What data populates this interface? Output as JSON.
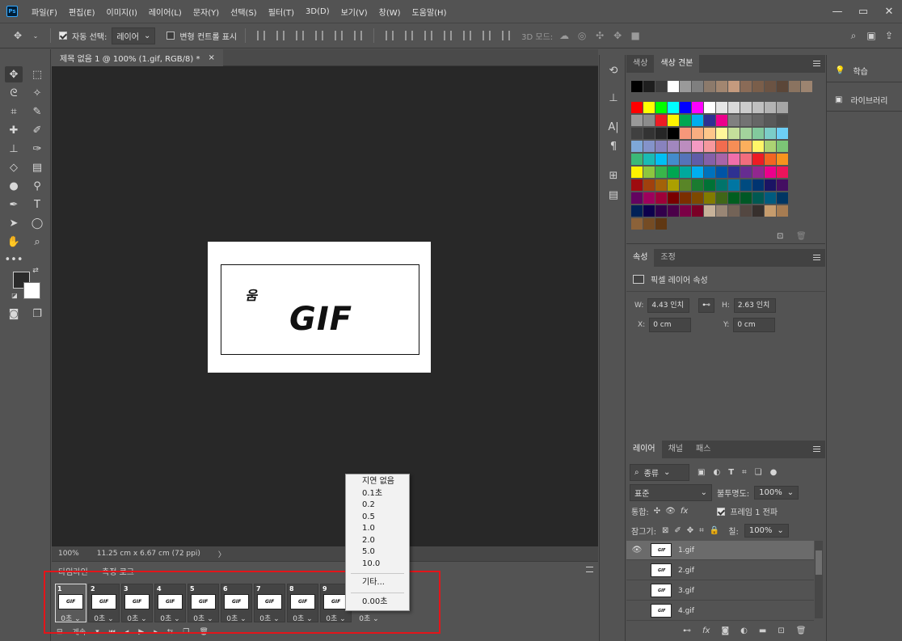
{
  "menubar": {
    "logo": "Ps",
    "items": [
      "파일(F)",
      "편집(E)",
      "이미지(I)",
      "레이어(L)",
      "문자(Y)",
      "선택(S)",
      "필터(T)",
      "3D(D)",
      "보기(V)",
      "창(W)",
      "도움말(H)"
    ]
  },
  "window": {
    "minimize": "—",
    "maximize": "▭",
    "close": "✕"
  },
  "options": {
    "auto_select_label": "자동 선택:",
    "auto_select_value": "레이어",
    "transform_label": "변형 컨트롤 표시",
    "mode_3d_label": "3D 모드:"
  },
  "document": {
    "tab_title": "제목 없음 1 @ 100% (1.gif, RGB/8) *",
    "tab_close": "×",
    "canvas_small_text": "움",
    "canvas_big_text": "GIF",
    "zoom": "100%",
    "doc_size": "11.25 cm x 6.67 cm (72 ppi)",
    "status_arrow": "〉"
  },
  "timeline": {
    "tab_timeline": "타임라인",
    "tab_measure": "측정 로그",
    "frames": [
      {
        "num": "1",
        "delay": "0초"
      },
      {
        "num": "2",
        "delay": "0초"
      },
      {
        "num": "3",
        "delay": "0초"
      },
      {
        "num": "4",
        "delay": "0초"
      },
      {
        "num": "5",
        "delay": "0초"
      },
      {
        "num": "6",
        "delay": "0초"
      },
      {
        "num": "7",
        "delay": "0초"
      },
      {
        "num": "8",
        "delay": "0초"
      },
      {
        "num": "9",
        "delay": "0초"
      },
      {
        "num": "",
        "delay": "0초"
      }
    ],
    "loop_label": "계속"
  },
  "delay_menu": {
    "items": [
      "지연 없음",
      "0.1초",
      "0.2",
      "0.5",
      "1.0",
      "2.0",
      "5.0",
      "10.0"
    ],
    "other": "기타...",
    "current": "0.00초"
  },
  "swatches": {
    "tab_color": "색상",
    "tab_swatches": "색상 견본",
    "rows": [
      [
        "#000000",
        "#1e1e1e",
        "#3c3c3c",
        "#ffffff",
        "#9a9a9a",
        "#7f7f7f",
        "#8c7a6b",
        "#a28670",
        "#c49a7e",
        "#8a6b57",
        "#7a5e4a",
        "#6b5343",
        "#5b4638",
        "#8a7360",
        "#9c8470"
      ],
      [
        "#ff0000",
        "#ffff00",
        "#00ff00",
        "#00ffff",
        "#0000ff",
        "#ff00ff",
        "#ffffff",
        "#e6e6e6",
        "#d9d9d9",
        "#cccccc",
        "#bfbfbf",
        "#b3b3b3",
        "#a6a6a6"
      ],
      [
        "#999999",
        "#8c8c8c",
        "#ed1c24",
        "#fff200",
        "#00a651",
        "#00aeef",
        "#2e3192",
        "#ec008c",
        "#808080",
        "#737373",
        "#666666",
        "#595959",
        "#4d4d4d"
      ],
      [
        "#404040",
        "#333333",
        "#262626",
        "#000000",
        "#f7977a",
        "#f9ad81",
        "#fdc68a",
        "#fff79a",
        "#c4df9b",
        "#a3d39c",
        "#82ca9d",
        "#7bcdc8",
        "#6dcff6"
      ],
      [
        "#7ea7d8",
        "#8493ca",
        "#8882be",
        "#a187be",
        "#bc8dbf",
        "#f49ac2",
        "#f6989d",
        "#f26c4f",
        "#f68e56",
        "#fbaf5d",
        "#fff568",
        "#acd373",
        "#7cc576"
      ],
      [
        "#3bb878",
        "#1abbb4",
        "#00bff3",
        "#438ccb",
        "#5574b9",
        "#605ca8",
        "#8560a8",
        "#a864a8",
        "#f06eaa",
        "#f26d7d",
        "#ed1c24",
        "#f26522",
        "#f7941d"
      ],
      [
        "#fff200",
        "#8dc63f",
        "#39b54a",
        "#00a651",
        "#00a99d",
        "#00aeef",
        "#0072bc",
        "#0054a6",
        "#2e3192",
        "#662d91",
        "#92278f",
        "#ec008c",
        "#ed145b"
      ],
      [
        "#9e0b0f",
        "#a0410d",
        "#a36209",
        "#aba000",
        "#598527",
        "#1a7b30",
        "#007236",
        "#00746b",
        "#0076a3",
        "#004b80",
        "#003471",
        "#1b1464",
        "#440e62"
      ],
      [
        "#630460",
        "#9e005d",
        "#9e0039",
        "#790000",
        "#7b2e00",
        "#7d4900",
        "#827b00",
        "#406618",
        "#005e20",
        "#005826",
        "#005952",
        "#005b7f",
        "#003663"
      ],
      [
        "#002157",
        "#0d004c",
        "#32004b",
        "#4b0049",
        "#7b0046",
        "#7a0026",
        "#c7b299",
        "#998675",
        "#736357",
        "#534741",
        "#37302d",
        "#c69c6d",
        "#a67c52"
      ],
      [
        "#8c6239",
        "#754c24",
        "#603813"
      ]
    ]
  },
  "properties": {
    "tab_props": "속성",
    "tab_adjust": "조정",
    "title": "픽셀 레이어 속성",
    "w_label": "W:",
    "w_value": "4.43 인치",
    "h_label": "H:",
    "h_value": "2.63 인치",
    "x_label": "X:",
    "x_value": "0 cm",
    "y_label": "Y:",
    "y_value": "0 cm"
  },
  "layers": {
    "tab_layers": "레이어",
    "tab_channels": "채널",
    "tab_paths": "패스",
    "filter_label": "종류",
    "blend_mode": "표준",
    "opacity_label": "불투명도:",
    "opacity_value": "100%",
    "unify_label": "통합:",
    "propagate_label": "프레임 1 전파",
    "lock_label": "잠그기:",
    "fill_label": "칠:",
    "fill_value": "100%",
    "items": [
      {
        "name": "1.gif",
        "visible": "👁"
      },
      {
        "name": "2.gif",
        "visible": ""
      },
      {
        "name": "3.gif",
        "visible": ""
      },
      {
        "name": "4.gif",
        "visible": ""
      }
    ]
  },
  "dock": {
    "learn": "학습",
    "libraries": "라이브러리"
  }
}
